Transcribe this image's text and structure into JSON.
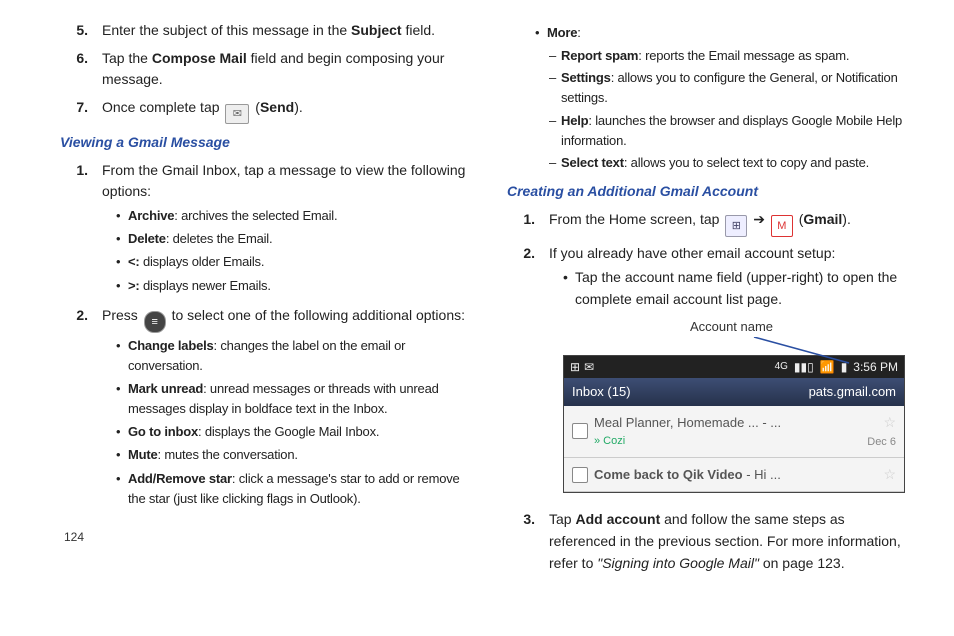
{
  "pageNumber": "124",
  "left": {
    "step5_num": "5.",
    "step5_a": "Enter the subject of this message in the ",
    "step5_b": "Subject",
    "step5_c": " field.",
    "step6_num": "6.",
    "step6_a": "Tap the ",
    "step6_b": "Compose Mail",
    "step6_c": " field and begin composing your message.",
    "step7_num": "7.",
    "step7_a": "Once complete tap ",
    "step7_send_open": " (",
    "step7_send_b": "Send",
    "step7_send_close": ").",
    "heading_view": "Viewing a Gmail Message",
    "v1_num": "1.",
    "v1": "From the Gmail Inbox, tap a message to view the following options:",
    "v1_arch_b": "Archive",
    "v1_arch_t": ": archives the selected Email.",
    "v1_del_b": "Delete",
    "v1_del_t": ": deletes the Email.",
    "v1_lt_b": "<:",
    "v1_lt_t": " displays older Emails.",
    "v1_gt_b": ">:",
    "v1_gt_t": " displays newer Emails.",
    "v2_num": "2.",
    "v2_a": "Press ",
    "v2_b": " to select one of the following additional options:",
    "v2_cl_b": "Change labels",
    "v2_cl_t": ": changes the label on the email or conversation.",
    "v2_mu_b": "Mark unread",
    "v2_mu_t": ": unread messages or threads with unread messages display in boldface text in the Inbox.",
    "v2_gi_b": "Go to inbox",
    "v2_gi_t": ": displays the Google Mail Inbox.",
    "v2_mt_b": "Mute",
    "v2_mt_t": ": mutes the conversation.",
    "v2_st_b": "Add/Remove star",
    "v2_st_t": ": click a message's star to add or remove the star (just like clicking flags in Outlook)."
  },
  "right": {
    "more_b": "More",
    "more_t": ":",
    "rs_b": "Report spam",
    "rs_t": ": reports the Email message as spam.",
    "st_b": "Settings",
    "st_t": ": allows you to configure the General, or Notification settings.",
    "hp_b": "Help",
    "hp_t": ": launches the browser and displays Google Mobile Help information.",
    "sl_b": "Select text",
    "sl_t": ": allows you to select text to copy and paste.",
    "heading_create": "Creating an Additional Gmail Account",
    "c1_num": "1.",
    "c1_a": "From the Home screen, tap ",
    "c1_arrow": " ➔ ",
    "c1_open": " (",
    "c1_gm_b": "Gmail",
    "c1_close": ").",
    "c2_num": "2.",
    "c2": "If you already have other email account setup:",
    "c2_tap": "Tap the account name field (upper-right) to open the complete email account list page.",
    "account_label": "Account name",
    "phone": {
      "time": "3:56 PM",
      "sig4g": "4G",
      "inbox": "Inbox (15)",
      "account": "pats.gmail.com",
      "row1_title": "Meal Planner, Homemade ... - ...",
      "row1_sub": "»  Cozi",
      "row1_date": "Dec 6",
      "row2_bold": "Come back to Qik Video",
      "row2_rest": " - Hi ..."
    },
    "c3_num": "3.",
    "c3_a": "Tap ",
    "c3_b": "Add account",
    "c3_c": " and follow the same steps as referenced in the previous section. For more information, refer to ",
    "c3_ref_i": "\"Signing into Google Mail\"",
    "c3_ref_t": "  on page 123."
  }
}
